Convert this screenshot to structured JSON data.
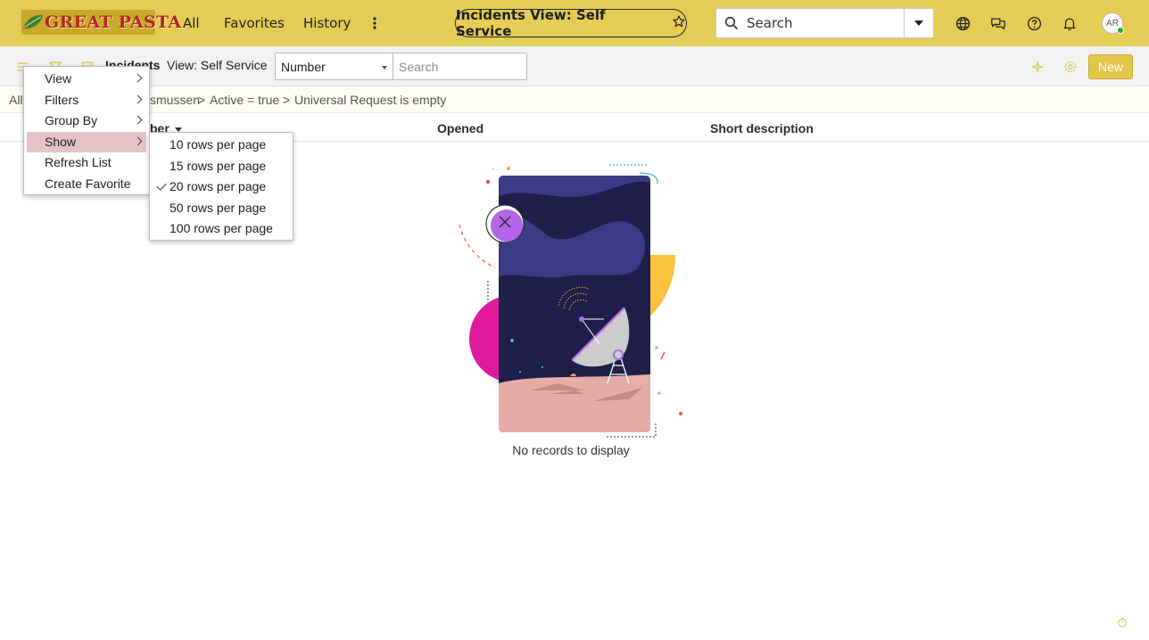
{
  "header": {
    "logo_text": "GREAT PASTA",
    "nav": {
      "all": "All",
      "favorites": "Favorites",
      "history": "History"
    },
    "context_title": "Incidents View: Self Service",
    "search_placeholder": "Search",
    "avatar_initials": "AR",
    "icons": [
      "globe-icon",
      "chat-icon",
      "help-icon",
      "bell-icon"
    ]
  },
  "toolbar": {
    "title": "Incidents",
    "view_label": "View: Self Service",
    "search_field": "Number",
    "search_placeholder": "Search",
    "new_label": "New"
  },
  "breadcrumb": {
    "all": "All",
    "caller_partial": "smussen",
    "sep1": ">",
    "active_filter": "Active = true",
    "sep2": ">",
    "request_filter": "Universal Request is empty"
  },
  "columns": {
    "number_partial": "ber",
    "opened": "Opened",
    "short_description": "Short description"
  },
  "empty_state": {
    "message": "No records to display"
  },
  "context_menu": {
    "items": [
      {
        "label": "View",
        "has_submenu": true
      },
      {
        "label": "Filters",
        "has_submenu": true
      },
      {
        "label": "Group By",
        "has_submenu": true
      },
      {
        "label": "Show",
        "has_submenu": true,
        "active": true
      },
      {
        "label": "Refresh List",
        "has_submenu": false
      },
      {
        "label": "Create Favorite",
        "has_submenu": false
      }
    ]
  },
  "show_submenu": {
    "items": [
      {
        "label": "10 rows per page",
        "checked": false
      },
      {
        "label": "15 rows per page",
        "checked": false
      },
      {
        "label": "20 rows per page",
        "checked": true
      },
      {
        "label": "50 rows per page",
        "checked": false
      },
      {
        "label": "100 rows per page",
        "checked": false
      }
    ]
  },
  "colors": {
    "banner": "#e3cd55",
    "accent_button": "#e2c74d",
    "menu_highlight": "#e6c3c6"
  }
}
